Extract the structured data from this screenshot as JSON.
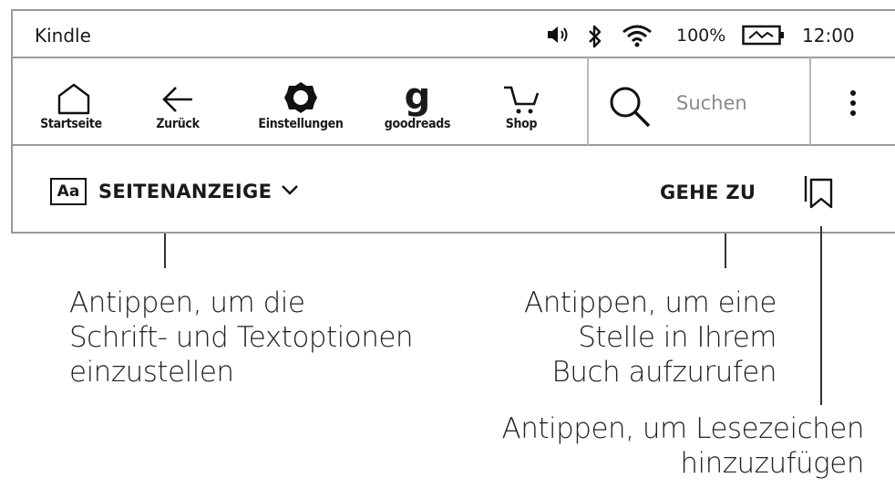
{
  "status": {
    "app_title": "Kindle",
    "battery_percent": "100%",
    "time": "12:00",
    "icons": [
      "volume-icon",
      "bluetooth-icon",
      "wifi-icon",
      "battery-charging-icon"
    ]
  },
  "toolbar": {
    "home_label": "Startseite",
    "back_label": "Zurück",
    "settings_label": "Einstellungen",
    "goodreads_label": "goodreads",
    "goodreads_glyph": "g",
    "shop_label": "Shop",
    "search_placeholder": "Suchen"
  },
  "reader_bar": {
    "font_badge": "Aa",
    "page_display_label": "SEITENANZEIGE",
    "goto_label": "GEHE ZU"
  },
  "annotations": {
    "font": [
      "Antippen, um die",
      "Schrift- und Textoptionen",
      "einzustellen"
    ],
    "goto": [
      "Antippen, um eine",
      "Stelle in Ihrem",
      "Buch aufzurufen"
    ],
    "bookmark": [
      "Antippen, um Lesezeichen",
      "hinzuzufügen"
    ]
  }
}
